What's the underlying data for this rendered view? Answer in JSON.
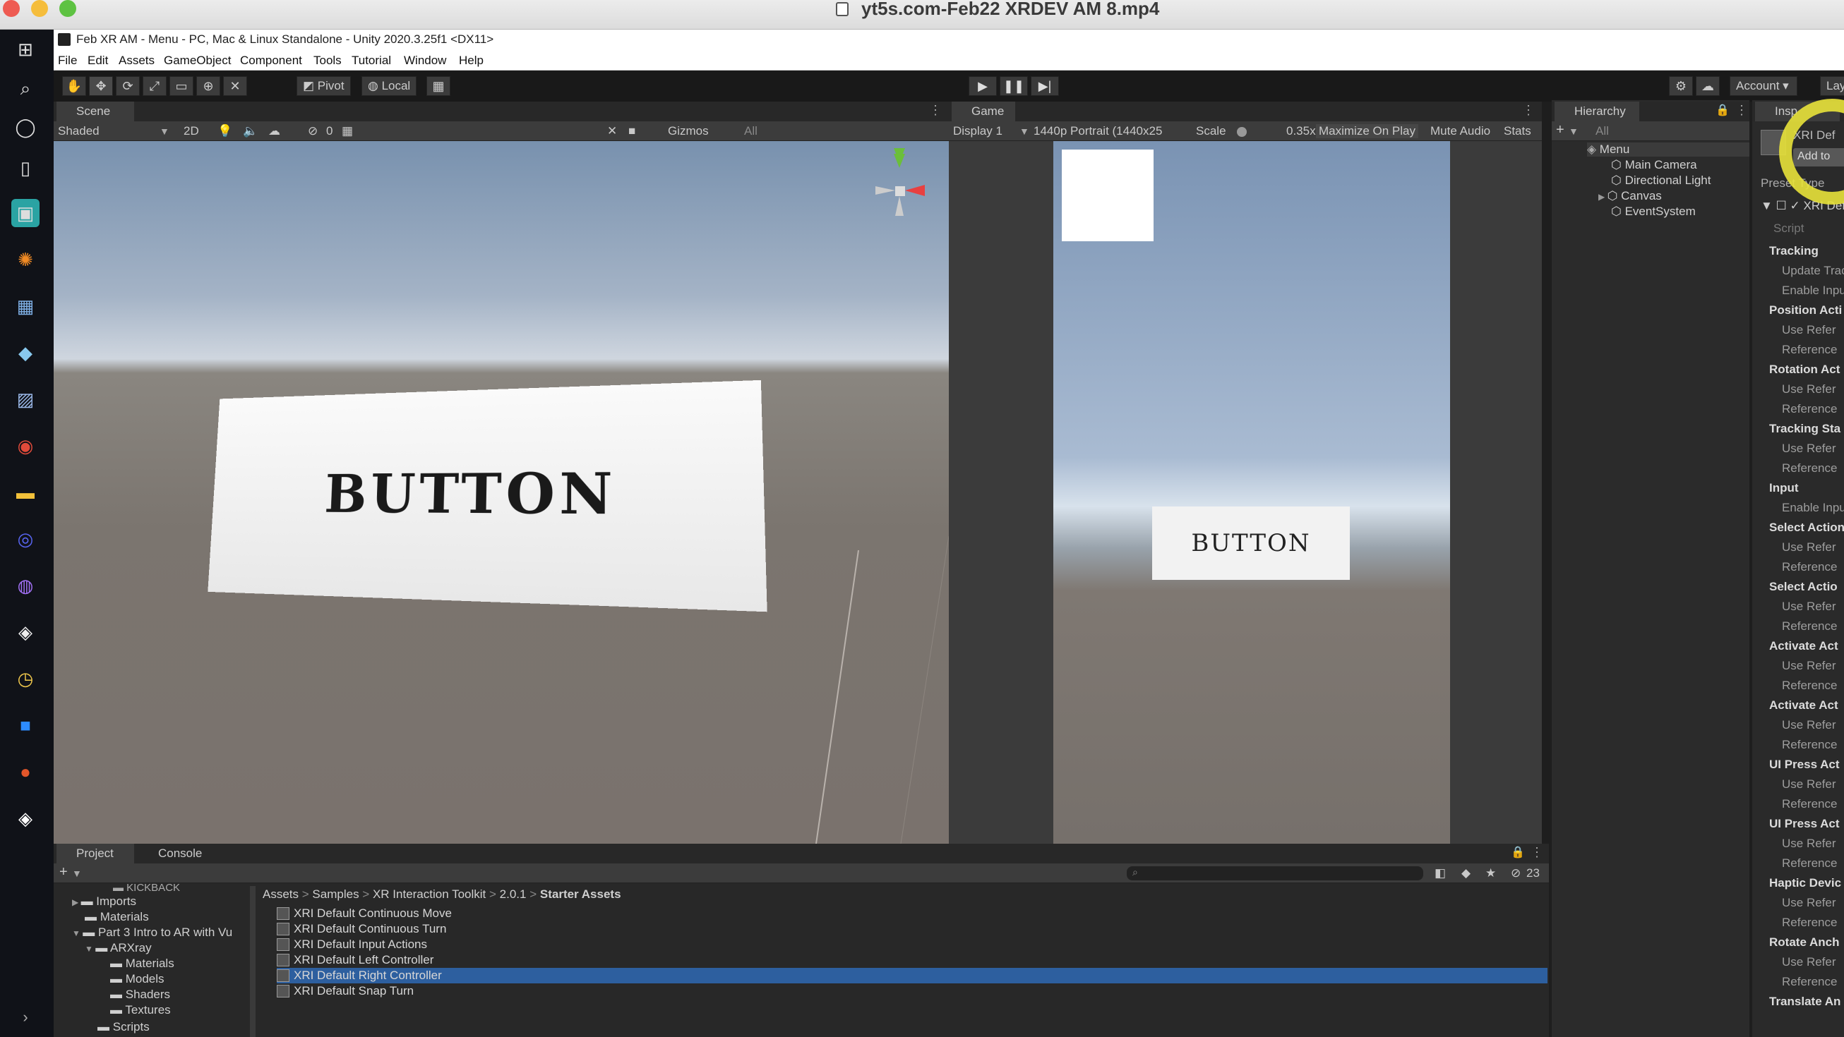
{
  "mac_title": "yt5s.com-Feb22 XRDEV AM 8.mp4",
  "unity_title": "Feb XR AM - Menu - PC, Mac & Linux Standalone - Unity 2020.3.25f1 <DX11>",
  "menu": [
    "File",
    "Edit",
    "Assets",
    "GameObject",
    "Component",
    "Tools",
    "Tutorial",
    "Window",
    "Help"
  ],
  "toolbar": {
    "pivot": "Pivot",
    "local": "Local",
    "account": "Account",
    "layers": "Lay"
  },
  "scene": {
    "tab": "Scene",
    "shading": "Shaded",
    "mode_2d": "2D",
    "gizmos": "Gizmos",
    "search": "All",
    "hidden_count": "0",
    "button_text": "BUTTON"
  },
  "game": {
    "tab": "Game",
    "display": "Display 1",
    "resolution": "1440p Portrait (1440x25",
    "scale_label": "Scale",
    "scale_value": "0.35x",
    "maximize": "Maximize On Play",
    "mute": "Mute Audio",
    "stats": "Stats",
    "button_text": "BUTTON"
  },
  "hierarchy": {
    "tab": "Hierarchy",
    "search": "All",
    "root": "Menu",
    "children": [
      "Main Camera",
      "Directional Light",
      "Canvas",
      "EventSystem"
    ]
  },
  "inspector": {
    "tab": "Insp",
    "object": "XRI Def",
    "add_button": "Add to",
    "preset_type": "Preset Type",
    "script": "Script",
    "rows": [
      {
        "t": "h",
        "label": "Tracking"
      },
      {
        "t": "s",
        "label": "Update Track"
      },
      {
        "t": "s",
        "label": "Enable Input"
      },
      {
        "t": "h",
        "label": "Position Acti"
      },
      {
        "t": "s",
        "label": "Use Refer"
      },
      {
        "t": "s",
        "label": "Reference"
      },
      {
        "t": "h",
        "label": "Rotation Act"
      },
      {
        "t": "s",
        "label": "Use Refer"
      },
      {
        "t": "s",
        "label": "Reference"
      },
      {
        "t": "h",
        "label": "Tracking Sta"
      },
      {
        "t": "s",
        "label": "Use Refer"
      },
      {
        "t": "s",
        "label": "Reference"
      },
      {
        "t": "h",
        "label": "Input"
      },
      {
        "t": "s",
        "label": "Enable Input"
      },
      {
        "t": "h",
        "label": "Select Action"
      },
      {
        "t": "s",
        "label": "Use Refer"
      },
      {
        "t": "s",
        "label": "Reference"
      },
      {
        "t": "h",
        "label": "Select Actio"
      },
      {
        "t": "s",
        "label": "Use Refer"
      },
      {
        "t": "s",
        "label": "Reference"
      },
      {
        "t": "h",
        "label": "Activate Act"
      },
      {
        "t": "s",
        "label": "Use Refer"
      },
      {
        "t": "s",
        "label": "Reference"
      },
      {
        "t": "h",
        "label": "Activate Act"
      },
      {
        "t": "s",
        "label": "Use Refer"
      },
      {
        "t": "s",
        "label": "Reference"
      },
      {
        "t": "h",
        "label": "UI Press Act"
      },
      {
        "t": "s",
        "label": "Use Refer"
      },
      {
        "t": "s",
        "label": "Reference"
      },
      {
        "t": "h",
        "label": "UI Press Act"
      },
      {
        "t": "s",
        "label": "Use Refer"
      },
      {
        "t": "s",
        "label": "Reference"
      },
      {
        "t": "h",
        "label": "Haptic Devic"
      },
      {
        "t": "s",
        "label": "Use Refer"
      },
      {
        "t": "s",
        "label": "Reference"
      },
      {
        "t": "h",
        "label": "Rotate Anch"
      },
      {
        "t": "s",
        "label": "Use Refer"
      },
      {
        "t": "s",
        "label": "Reference"
      },
      {
        "t": "h",
        "label": "Translate An"
      }
    ]
  },
  "project": {
    "tab_project": "Project",
    "tab_console": "Console",
    "tree": [
      "Kickback",
      "Imports",
      "Materials",
      "Part 3 Intro to AR with Vu",
      "ARXray",
      "Materials",
      "Models",
      "Shaders",
      "Textures",
      "Scripts"
    ],
    "breadcrumb": [
      "Assets",
      "Samples",
      "XR Interaction Toolkit",
      "2.0.1",
      "Starter Assets"
    ],
    "assets": [
      "XRI Default Continuous Move",
      "XRI Default Continuous Turn",
      "XRI Default Input Actions",
      "XRI Default Left Controller",
      "XRI Default Right Controller",
      "XRI Default Snap Turn"
    ],
    "selected_index": 4,
    "hidden_count": "23"
  },
  "colors": {
    "selection": "#2d5f9f",
    "highlight_ring": "#e8e23a"
  }
}
